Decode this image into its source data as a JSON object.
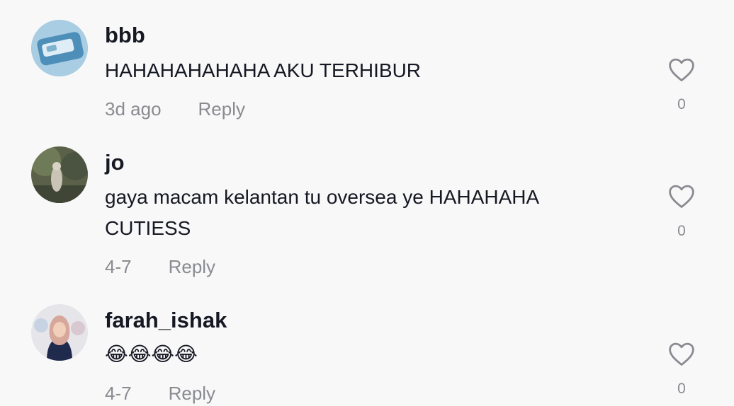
{
  "comments": [
    {
      "username": "bbb",
      "text": "HAHAHAHAHAHA AKU TERHIBUR",
      "time": "3d ago",
      "reply_label": "Reply",
      "likes": "0"
    },
    {
      "username": "jo",
      "text": "gaya macam kelantan tu oversea ye HAHAHAHA CUTIESS",
      "time": "4-7",
      "reply_label": "Reply",
      "likes": "0"
    },
    {
      "username": "farah_ishak",
      "text": "😂😂😂😂",
      "time": "4-7",
      "reply_label": "Reply",
      "likes": "0"
    }
  ],
  "icons": {
    "like": "heart-outline-icon"
  },
  "colors": {
    "primary_text": "#161823",
    "secondary_text": "#8a8b91",
    "background": "#f8f8f8"
  }
}
